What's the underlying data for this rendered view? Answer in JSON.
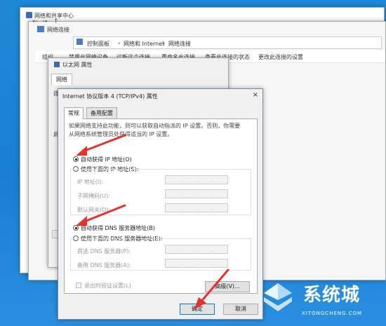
{
  "network_center": {
    "title": "网络和共享中心"
  },
  "network_connections": {
    "title": "网络连接",
    "breadcrumb": [
      "控制面板",
      "网络和 Internet",
      "网络连接"
    ],
    "commands": [
      "组织",
      "禁用此网络设备",
      "诊断这个连接",
      "重命名此连接",
      "查看此连接的状态",
      "更改此连接的设置"
    ]
  },
  "ethernet_props": {
    "title": "以太网 属性",
    "tab": "网络",
    "left_fragments": [
      "连",
      "此"
    ]
  },
  "ipv4": {
    "title": "Internet 协议版本 4 (TCP/IPv4) 属性",
    "close": "×",
    "tabs": [
      "常规",
      "备用配置"
    ],
    "description": "如果网络支持此功能，则可以获取自动指派的 IP 设置。否则，你需要从网络系统管理员处获得适当的 IP 设置。",
    "ip_auto": "自动获得 IP 地址(O)",
    "ip_manual": "使用下面的 IP 地址(S):",
    "ip_fields": [
      "IP 地址(I):",
      "子网掩码(U):",
      "默认网关(D):"
    ],
    "dns_auto": "自动获得 DNS 服务器地址(B)",
    "dns_manual": "使用下面的 DNS 服务器地址(E):",
    "dns_fields": [
      "首选 DNS 服务器(P):",
      "备用 DNS 服务器(A):"
    ],
    "validate": "退出时验证设置(L)",
    "advanced": "高级(V)...",
    "ok": "确定",
    "cancel": "取消",
    "dot": "."
  },
  "watermark": {
    "brand": "系统城",
    "site": "XITONGCHENG.COM"
  },
  "colors": {
    "desktop": "#1a7fd1",
    "annotation": "#e8312f",
    "accent": "#0078d7"
  }
}
